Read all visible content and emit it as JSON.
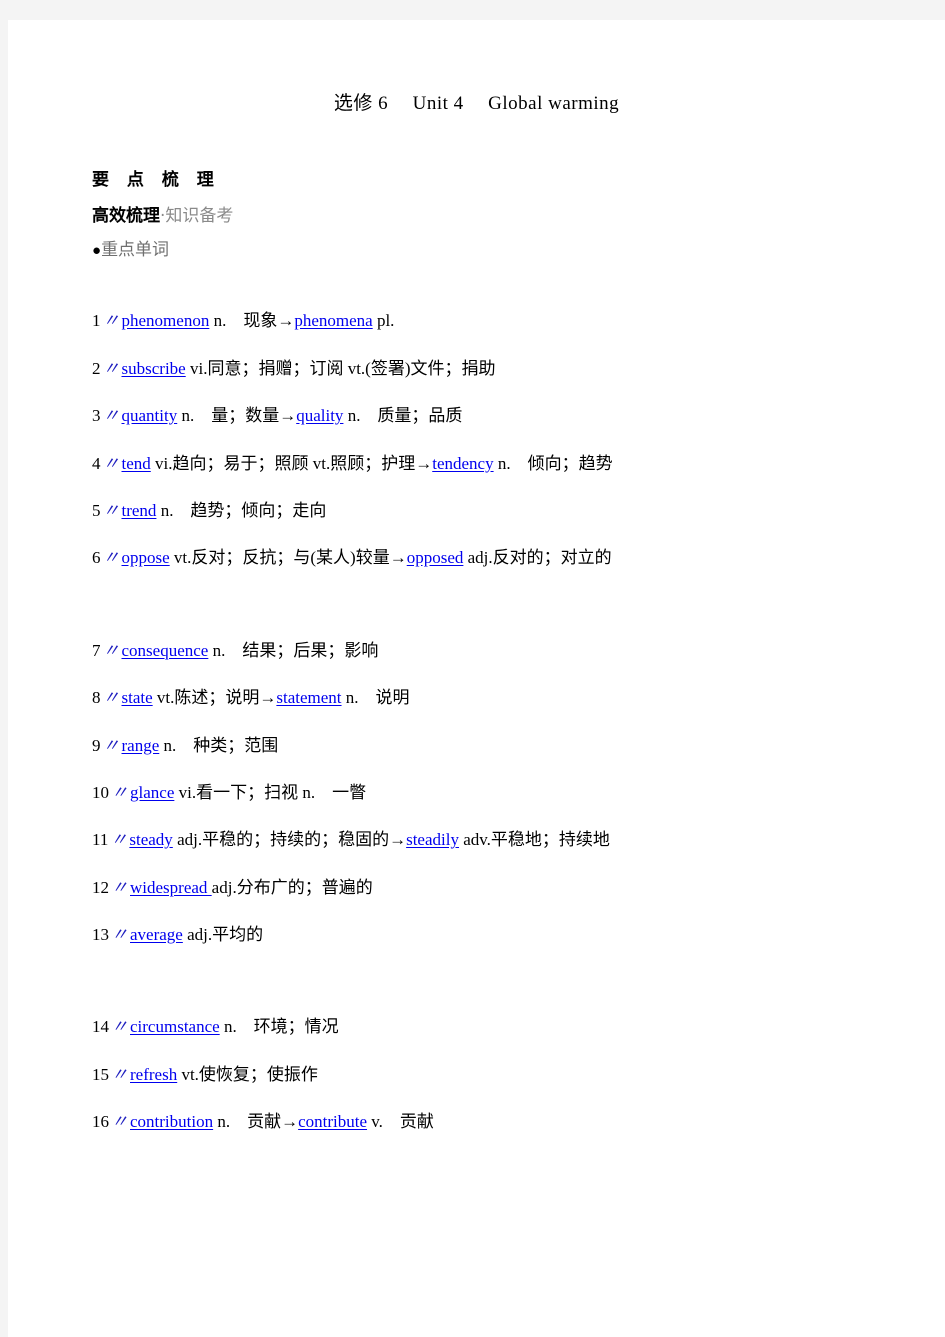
{
  "document": {
    "title_parts": {
      "book": "选修 6",
      "unit": "Unit 4",
      "topic": "Global warming"
    },
    "title_full": "选修 6　Unit 4　Global warming",
    "section_heading": "要 点 梳 理",
    "subheading_strong": "高效梳理",
    "subheading_muted": "·知识备考",
    "bullet_dot": "●",
    "bullet_label": "重点单词",
    "colors": {
      "page_background": "#ffffff",
      "canvas_background": "#f4f4f4",
      "term_link": "#0000ee",
      "mark": "#2020c0",
      "body_text": "#000000",
      "muted_text": "#8a8a8a",
      "bullet_text": "#6f6f6f"
    }
  },
  "words": [
    {
      "index": "1",
      "mark": "〃",
      "term": "phenomenon",
      "rest": " n.　现象→",
      "term2": "phenomena",
      "rest2": " pl.",
      "group_break": false
    },
    {
      "index": "2",
      "mark": "〃",
      "term": "subscribe",
      "rest": " vi.同意；捐赠；订阅  vt.(签署)文件；捐助",
      "term2": "",
      "rest2": "",
      "group_break": false
    },
    {
      "index": "3",
      "mark": "〃",
      "term": "quantity",
      "rest": " n.　量；数量→",
      "term2": "quality",
      "rest2": " n.　质量；品质",
      "group_break": false
    },
    {
      "index": "4",
      "mark": "〃",
      "term": "tend",
      "rest": " vi.趋向；易于；照顾  vt.照顾；护理→",
      "term2": "tendency",
      "rest2": " n.　倾向；趋势",
      "group_break": false
    },
    {
      "index": "5",
      "mark": "〃",
      "term": "trend",
      "rest": " n.　趋势；倾向；走向",
      "term2": "",
      "rest2": "",
      "group_break": false
    },
    {
      "index": "6",
      "mark": "〃",
      "term": "oppose",
      "rest": " vt.反对；反抗；与(某人)较量→",
      "term2": "opposed",
      "rest2": " adj.反对的；对立的",
      "group_break": false
    },
    {
      "index": "7",
      "mark": "〃",
      "term": "consequence",
      "rest": " n.　结果；后果；影响",
      "term2": "",
      "rest2": "",
      "group_break": true
    },
    {
      "index": "8",
      "mark": "〃",
      "term": "state",
      "rest": " vt.陈述；说明→",
      "term2": "statement",
      "rest2": " n.　说明",
      "group_break": false
    },
    {
      "index": "9",
      "mark": "〃",
      "term": "range",
      "rest": " n.　种类；范围",
      "term2": "",
      "rest2": "",
      "group_break": false
    },
    {
      "index": "10",
      "mark": "〃",
      "term": "glance",
      "rest": " vi.看一下；扫视  n.　一瞥",
      "term2": "",
      "rest2": "",
      "group_break": false
    },
    {
      "index": "11",
      "mark": "〃",
      "term": "steady",
      "rest": " adj.平稳的；持续的；稳固的→",
      "term2": "steadily",
      "rest2": " adv.平稳地；持续地",
      "group_break": false
    },
    {
      "index": "12",
      "mark": "〃",
      "term": "widespread ",
      "rest": " adj.分布广的；普遍的",
      "term2": "",
      "rest2": "",
      "group_break": false
    },
    {
      "index": "13",
      "mark": "〃",
      "term": "average",
      "rest": " adj.平均的",
      "term2": "",
      "rest2": "",
      "group_break": false
    },
    {
      "index": "14",
      "mark": "〃",
      "term": "circumstance",
      "rest": " n.　环境；情况",
      "term2": "",
      "rest2": "",
      "group_break": true
    },
    {
      "index": "15",
      "mark": "〃",
      "term": "refresh",
      "rest": " vt.使恢复；使振作",
      "term2": "",
      "rest2": "",
      "group_break": false
    },
    {
      "index": "16",
      "mark": "〃",
      "term": "contribution",
      "rest": " n.　贡献→",
      "term2": "contribute",
      "rest2": " v.　贡献",
      "group_break": false
    }
  ]
}
